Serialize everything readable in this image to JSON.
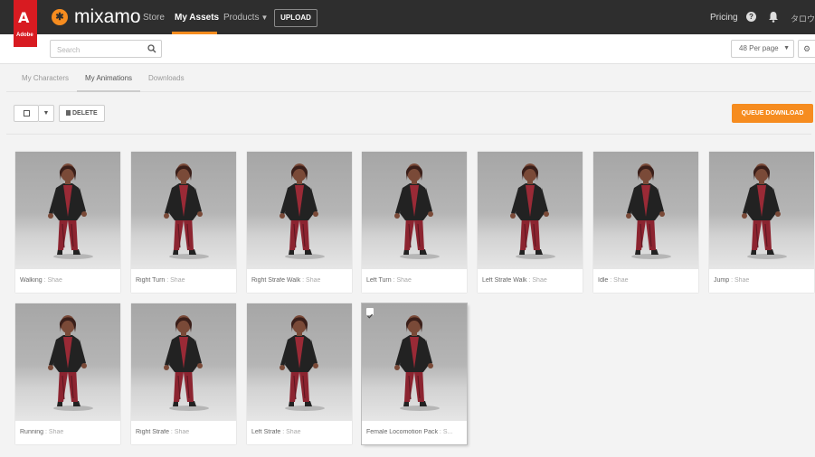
{
  "topnav": {
    "adobe_label": "Adobe",
    "brand": "mixamo",
    "links": [
      "Store",
      "My Assets",
      "Products"
    ],
    "upload_label": "UPLOAD",
    "pricing_label": "Pricing",
    "user_name": "タロウ"
  },
  "search": {
    "placeholder": "Search"
  },
  "per_page": {
    "selected": "48 Per page"
  },
  "tabs": [
    "My Characters",
    "My Animations",
    "Downloads"
  ],
  "toolbar": {
    "delete_label": "DELETE",
    "queue_label": "QUEUE DOWNLOAD"
  },
  "cards": [
    {
      "name": "Walking",
      "character": "Shae"
    },
    {
      "name": "Right Turn",
      "character": "Shae"
    },
    {
      "name": "Right Strafe Walk",
      "character": "Shae"
    },
    {
      "name": "Left Turn",
      "character": "Shae"
    },
    {
      "name": "Left Strafe Walk",
      "character": "Shae"
    },
    {
      "name": "Idle",
      "character": "Shae"
    },
    {
      "name": "Jump",
      "character": "Shae"
    },
    {
      "name": "Running",
      "character": "Shae"
    },
    {
      "name": "Right Strafe",
      "character": "Shae"
    },
    {
      "name": "Left Strafe",
      "character": "Shae"
    },
    {
      "name": "Female Locomotion Pack",
      "character": "S...",
      "selected": true
    }
  ],
  "colors": {
    "accent": "#f68c1f",
    "topbar": "#2e2e2e",
    "adobe_red": "#d81b21"
  }
}
